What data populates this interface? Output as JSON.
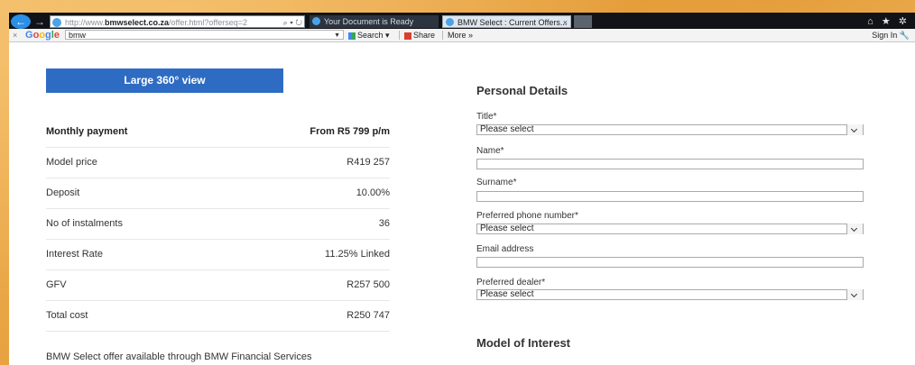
{
  "browser": {
    "address": {
      "prefix": "http://www.",
      "domain": "bmwselect.co.za",
      "path": "/offer.html?offerseq=2",
      "controls": "⌕ ▾ ↻"
    },
    "tabs": [
      {
        "label": "Your Document is Ready"
      },
      {
        "label": "BMW Select : Current Offers...",
        "close": "×"
      }
    ],
    "toolbar_icons": "⌂ ★ ✲",
    "favbar": {
      "close": "×",
      "google_logo": [
        "G",
        "o",
        "o",
        "g",
        "l",
        "e"
      ],
      "search_value": "bmw",
      "search_dropdown": "▼",
      "search_btn": "Search ▾",
      "share_btn": "Share",
      "more": "More »",
      "signin": "Sign In"
    }
  },
  "left": {
    "view_button": "Large 360° view",
    "rows": [
      {
        "label": "Monthly payment",
        "value": "From R5 799 p/m"
      },
      {
        "label": "Model price",
        "value": "R419 257"
      },
      {
        "label": "Deposit",
        "value": "10.00%"
      },
      {
        "label": "No of instalments",
        "value": "36"
      },
      {
        "label": "Interest Rate",
        "value": "11.25% Linked"
      },
      {
        "label": "GFV",
        "value": "R257 500"
      },
      {
        "label": "Total cost",
        "value": "R250 747"
      }
    ],
    "footnote": "BMW Select offer available through BMW Financial Services"
  },
  "form": {
    "heading": "Personal Details",
    "title_label": "Title*",
    "title_value": "Please select",
    "name_label": "Name*",
    "surname_label": "Surname*",
    "phone_label": "Preferred phone number*",
    "phone_value": "Please select",
    "email_label": "Email address",
    "dealer_label": "Preferred dealer*",
    "dealer_value": "Please select",
    "model_heading": "Model of Interest"
  },
  "colors": {
    "accent": "#2e6cc3",
    "frame": "#e8a23c"
  }
}
